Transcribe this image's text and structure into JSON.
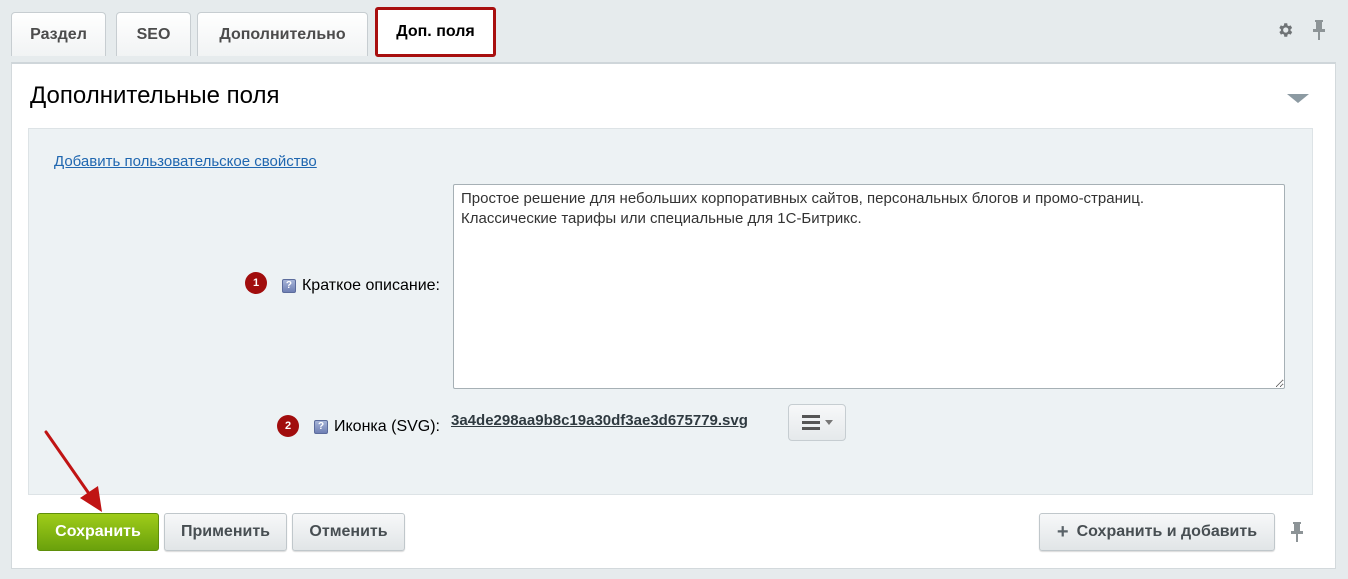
{
  "tabs": [
    {
      "label": "Раздел"
    },
    {
      "label": "SEO"
    },
    {
      "label": "Дополнительно"
    },
    {
      "label": "Доп. поля",
      "active": true
    }
  ],
  "top_icons": {
    "settings": "gear-icon",
    "pin": "pin-icon"
  },
  "section": {
    "title": "Дополнительные поля",
    "toggle_icon": "triangle-down-icon"
  },
  "add_property_link": "Добавить пользовательское свойство",
  "fields": {
    "short_description": {
      "badge": "1",
      "label": "Краткое описание:",
      "value": "Простое решение для небольших корпоративных сайтов, персональных блогов и промо-страниц.\nКлассические тарифы или специальные для 1С-Битрикс."
    },
    "icon_svg": {
      "badge": "2",
      "label": "Иконка (SVG):",
      "file_name": "3a4de298aa9b8c19a30df3ae3d675779.svg"
    }
  },
  "footer": {
    "save_label": "Сохранить",
    "apply_label": "Применить",
    "cancel_label": "Отменить",
    "save_add_label": "Сохранить и добавить"
  },
  "colors": {
    "active_tab_border": "#a80f0f",
    "save_button": "#7cb30f",
    "link": "#2067b0",
    "badge": "#a10d0d",
    "arrow": "#c01414"
  }
}
